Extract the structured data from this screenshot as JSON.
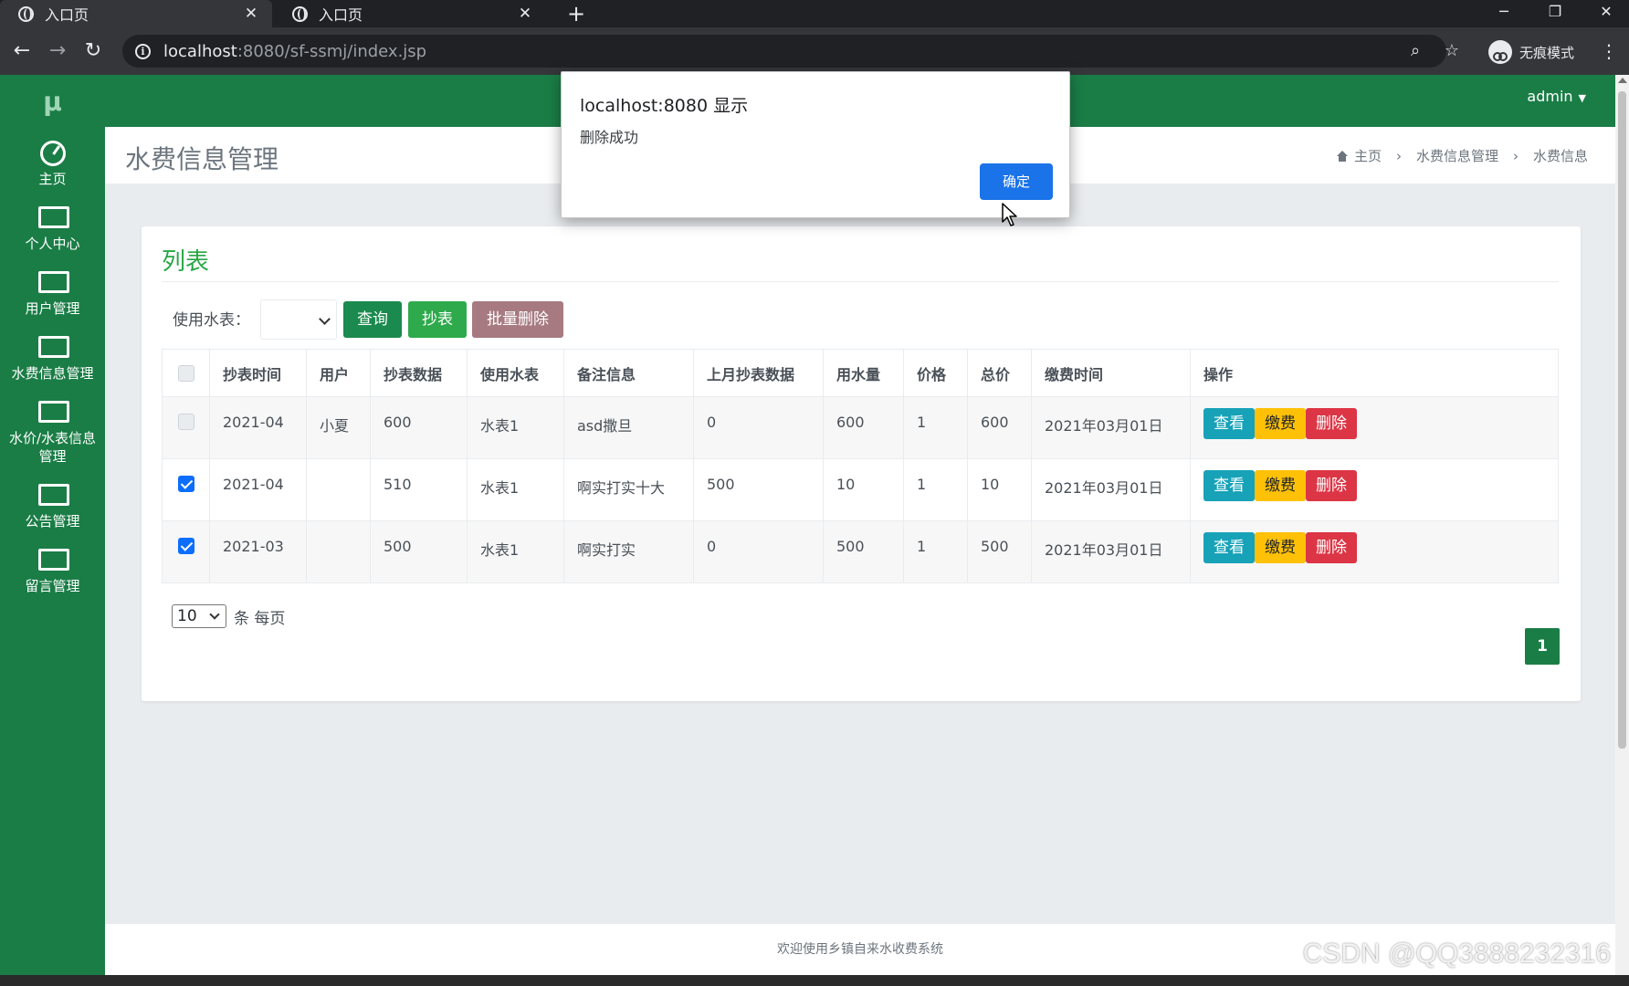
{
  "browser": {
    "tabs": [
      {
        "title": "入口页",
        "active": true
      },
      {
        "title": "入口页",
        "active": false
      }
    ],
    "url_host": "localhost",
    "url_path": ":8080/sf-ssmj/index.jsp",
    "incognito_label": "无痕模式"
  },
  "sidebar": {
    "logo": "μ",
    "items": [
      {
        "label": "主页",
        "icon": "dashboard-icon"
      },
      {
        "label": "个人中心",
        "icon": "monitor-icon"
      },
      {
        "label": "用户管理",
        "icon": "monitor-icon"
      },
      {
        "label": "水费信息管理",
        "icon": "monitor-icon"
      },
      {
        "label": "水价/水表信息管理",
        "icon": "monitor-icon"
      },
      {
        "label": "公告管理",
        "icon": "monitor-icon"
      },
      {
        "label": "留言管理",
        "icon": "monitor-icon"
      }
    ]
  },
  "topbar": {
    "user": "admin"
  },
  "header": {
    "title": "水费信息管理",
    "breadcrumb": [
      "主页",
      "水费信息管理",
      "水费信息"
    ]
  },
  "card": {
    "title": "列表",
    "filter_label": "使用水表：",
    "buttons": {
      "query": "查询",
      "read": "抄表",
      "batch_delete": "批量删除"
    }
  },
  "table": {
    "headers": [
      "抄表时间",
      "用户",
      "抄表数据",
      "使用水表",
      "备注信息",
      "上月抄表数据",
      "用水量",
      "价格",
      "总价",
      "缴费时间",
      "操作"
    ],
    "rows": [
      {
        "checked": false,
        "cells": [
          "2021-04",
          "小夏",
          "600",
          "水表1",
          "asd撒旦",
          "0",
          "600",
          "1",
          "600",
          "2021年03月01日"
        ]
      },
      {
        "checked": true,
        "cells": [
          "2021-04",
          "",
          "510",
          "水表1",
          "啊实打实十大",
          "500",
          "10",
          "1",
          "10",
          "2021年03月01日"
        ]
      },
      {
        "checked": true,
        "cells": [
          "2021-03",
          "",
          "500",
          "水表1",
          "啊实打实",
          "0",
          "500",
          "1",
          "500",
          "2021年03月01日"
        ]
      }
    ],
    "actions": {
      "view": "查看",
      "pay": "缴费",
      "delete": "删除"
    }
  },
  "pagination": {
    "page_size": "10",
    "page_size_suffix": "条 每页",
    "current_page": "1"
  },
  "footer": {
    "text": "欢迎使用乡镇自来水收费系统"
  },
  "dialog": {
    "title": "localhost:8080 显示",
    "message": "删除成功",
    "ok_label": "确定"
  },
  "watermark": "CSDN @QQ3888232316",
  "colors": {
    "brand": "#1a7d46",
    "view": "#17a2b8",
    "pay": "#ffc107",
    "delete": "#dc3545",
    "dialog_ok": "#1a73e8"
  }
}
